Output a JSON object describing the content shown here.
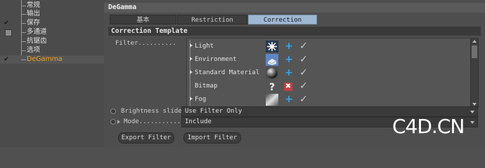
{
  "tree": {
    "items": [
      {
        "label": "常规",
        "check": ""
      },
      {
        "label": "输出",
        "check": ""
      },
      {
        "label": "保存",
        "check": "✔"
      },
      {
        "label": "多通道",
        "check": "box"
      },
      {
        "label": "抗锯齿",
        "check": ""
      },
      {
        "label": "选项",
        "check": ""
      },
      {
        "label": "DeGamma",
        "check": "✔",
        "active": true
      }
    ]
  },
  "panel": {
    "title": "DeGamma",
    "tabs": [
      "基本",
      "Restriction",
      "Correction Template"
    ],
    "selected_tab": "Correction Template",
    "section_title": "Correction Template",
    "filter_label": "Filter..........",
    "filters": [
      {
        "name": "Light",
        "thumb_icon": "light-icon",
        "action": "+",
        "action_icon": "add-icon"
      },
      {
        "name": "Environment",
        "thumb_icon": "environment-icon",
        "action": "+",
        "action_icon": "add-icon"
      },
      {
        "name": "Standard Material",
        "thumb_icon": "material-sphere-icon",
        "action": "+",
        "action_icon": "add-icon"
      },
      {
        "name": "Bitmap",
        "thumb_icon": "bitmap-question-icon",
        "action": "✖",
        "action_icon": "remove-icon"
      },
      {
        "name": "Fog",
        "thumb_icon": "fog-icon",
        "action": "+",
        "action_icon": "add-icon"
      }
    ],
    "brightness_label": "Brightness sliders",
    "brightness_value": "Use Filter Only",
    "mode_label": "Mode..............",
    "mode_value": "Include",
    "export_button": "Export Filter",
    "import_button": "Import Filter"
  },
  "watermark": "C4D.CN",
  "colors": {
    "active_item": "#f0a020",
    "selected_tab": "#9fb7d2",
    "add": "#3aa5e8",
    "remove": "#c04040"
  }
}
